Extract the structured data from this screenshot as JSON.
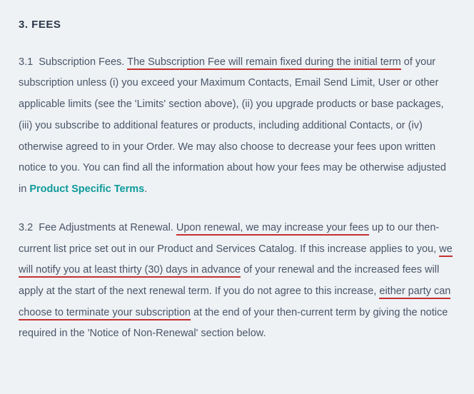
{
  "heading": "3.  FEES",
  "p1": {
    "num": "3.1",
    "title": "Subscription Fees.",
    "u1": "The Subscription Fee will remain fixed during the initial term",
    "rest1": " of your subscription unless (i) you exceed your Maximum Contacts, Email Send Limit, User or other applicable limits (see the 'Limits' section above), (ii) you upgrade products or base packages, (iii) you subscribe to additional features or products, including additional Contacts, or (iv) otherwise agreed to in your Order. We may also choose to decrease your fees upon written notice to you. You can find all the information about how your fees may be otherwise adjusted in ",
    "link": "Product Specific Terms",
    "period": "."
  },
  "p2": {
    "num": "3.2",
    "title": "Fee Adjustments at Renewal.",
    "u1": "Upon renewal, we may increase your fees",
    "t1": " up to our then-current list price set out in our Product and Services Catalog. If this increase applies to you, ",
    "u2": "we will notify you at least thirty (30) days in advance",
    "t2": " of your renewal and the increased fees will apply at the start of the next renewal term. If you do not agree to this increase, ",
    "u3": "either party can choose to terminate your subscription",
    "t3": " at the end of your then-current term by giving the notice required in the 'Notice of Non-Renewal' section below."
  }
}
